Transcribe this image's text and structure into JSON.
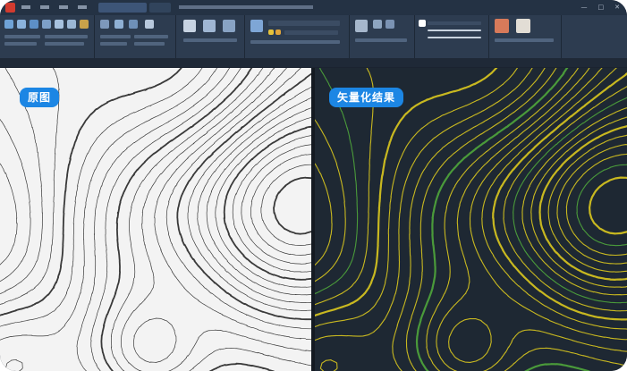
{
  "badges": {
    "left": "原图",
    "right": "矢量化结果"
  },
  "colors": {
    "badge": "#1c86e4",
    "ribbon": "#2d3c50",
    "left_background": "#f3f3f3",
    "left_contour": "#3a3a3a",
    "right_background": "#1e2833",
    "right_contour": "#c8b820",
    "right_contour_accent": "#4a9a3a"
  },
  "icons": [
    "app-logo-icon",
    "minimize-icon",
    "maximize-icon",
    "close-icon"
  ]
}
